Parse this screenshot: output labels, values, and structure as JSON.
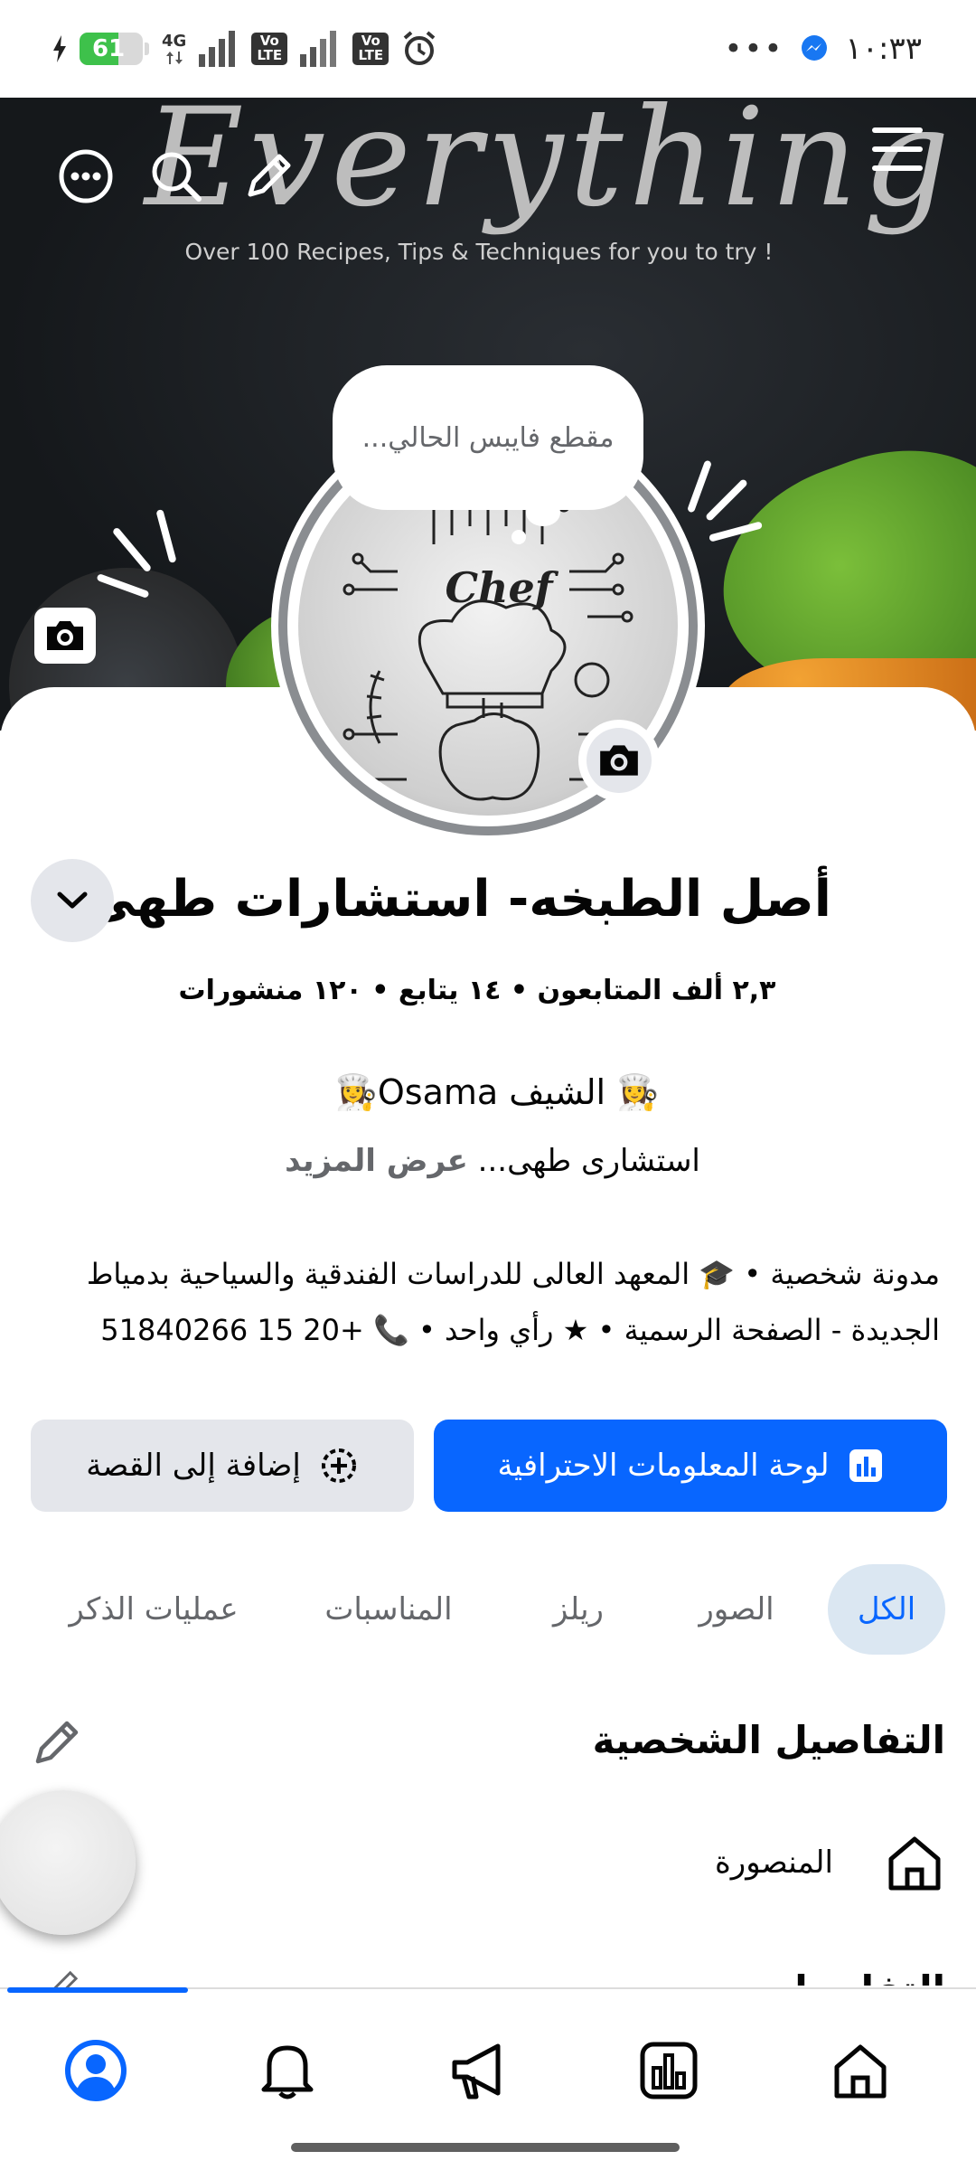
{
  "status_bar": {
    "time": "١٠:٣٣",
    "battery": 61,
    "network_label": "4G",
    "volte_label": "Vo LTE",
    "more_label": "•••"
  },
  "cover": {
    "title_text": "Everything",
    "subtitle_text": "Over 100 Recipes, Tips & Techniques for you to try !"
  },
  "avatar": {
    "note_bubble": "مقطع فايبس الحالي...",
    "logo_text": "Chef"
  },
  "profile": {
    "name": "أصل الطبخه- استشارات طهى",
    "stats": "٢,٣ ألف المتابعون • ١٤ يتابع • ١٢٠ منشورات",
    "bio_line1": "👩‍🍳 الشيف Osama👩‍🍳",
    "bio_line2": "استشارى طهى...",
    "see_more": "عرض المزيد",
    "details_line1": "مدونة شخصية • 🎓 المعهد العالى للدراسات الفندقية والسياحية بدمياط",
    "details_line2": "الجديدة - الصفحة الرسمية • ★ رأي واحد • 📞 +20 15 51840266"
  },
  "actions": {
    "professional_dashboard": "لوحة المعلومات الاحترافية",
    "add_to_story": "إضافة إلى القصة"
  },
  "tabs": [
    {
      "label": "الكل",
      "active": true
    },
    {
      "label": "الصور",
      "active": false
    },
    {
      "label": "ريلز",
      "active": false
    },
    {
      "label": "المناسبات",
      "active": false
    },
    {
      "label": "عمليات الذكر",
      "active": false
    }
  ],
  "personal_details": {
    "title": "التفاصيل الشخصية",
    "location": "المنصورة",
    "next_section_partial": "التفاصيل"
  },
  "bottom_nav": {
    "items": [
      "home-icon",
      "insights-icon",
      "megaphone-icon",
      "bell-icon",
      "profile-icon"
    ],
    "active": "profile-icon"
  },
  "colors": {
    "accent": "#0866ff",
    "button_gray": "#e4e6eb",
    "tab_active_bg": "#dbe7f2",
    "battery_green": "#3ec14b"
  }
}
